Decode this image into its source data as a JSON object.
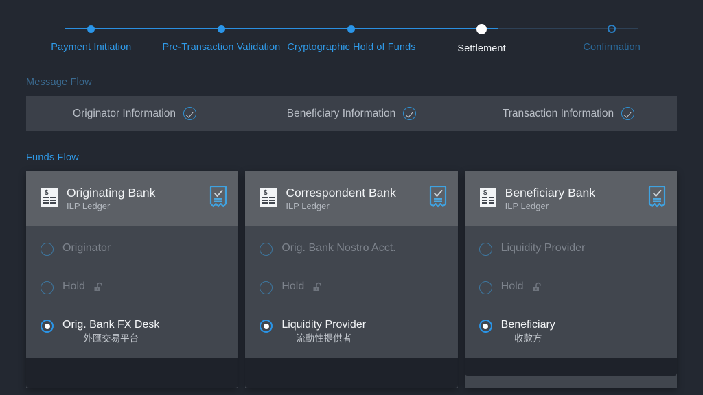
{
  "theme": {
    "background": "#232831",
    "accent_blue": "#2a95e8",
    "muted_blue": "#2a6a9b",
    "card_body": "#41464e",
    "card_header": "#5c6066",
    "bar": "#3b4049",
    "text_primary": "#f2f4f6",
    "text_muted": "#7d838c"
  },
  "stepper": {
    "steps": [
      {
        "label": "Payment Initiation",
        "state": "done"
      },
      {
        "label": "Pre-Transaction Validation",
        "state": "done"
      },
      {
        "label": "Cryptographic Hold of Funds",
        "state": "done"
      },
      {
        "label": "Settlement",
        "state": "current"
      },
      {
        "label": "Confirmation",
        "state": "future"
      }
    ]
  },
  "message_flow": {
    "label": "Message Flow",
    "items": [
      {
        "label": "Originator Information",
        "status_icon": "check-circle-icon",
        "checked": true
      },
      {
        "label": "Beneficiary Information",
        "status_icon": "check-circle-icon",
        "checked": true
      },
      {
        "label": "Transaction Information",
        "status_icon": "check-circle-icon",
        "checked": true
      }
    ]
  },
  "funds_flow": {
    "label": "Funds Flow",
    "cards": [
      {
        "title": "Originating Bank",
        "subtitle": "ILP Ledger",
        "header_icon": "receipt-icon",
        "badge_icon": "certificate-check-icon",
        "rows": [
          {
            "label": "Originator",
            "sub": "",
            "selected": false,
            "icon": ""
          },
          {
            "label": "Hold",
            "sub": "",
            "selected": false,
            "icon": "unlocked-padlock-icon"
          },
          {
            "label": "Orig. Bank FX Desk",
            "sub": "外匯交易平台",
            "selected": true,
            "icon": ""
          }
        ]
      },
      {
        "title": "Correspondent Bank",
        "subtitle": "ILP Ledger",
        "header_icon": "receipt-icon",
        "badge_icon": "certificate-check-icon",
        "rows": [
          {
            "label": "Orig. Bank Nostro Acct.",
            "sub": "",
            "selected": false,
            "icon": ""
          },
          {
            "label": "Hold",
            "sub": "",
            "selected": false,
            "icon": "unlocked-padlock-icon"
          },
          {
            "label": "Liquidity Provider",
            "sub": "流動性提供者",
            "selected": true,
            "icon": ""
          }
        ]
      },
      {
        "title": "Beneficiary Bank",
        "subtitle": "ILP Ledger",
        "header_icon": "receipt-icon",
        "badge_icon": "certificate-check-icon",
        "rows": [
          {
            "label": "Liquidity Provider",
            "sub": "",
            "selected": false,
            "icon": ""
          },
          {
            "label": "Hold",
            "sub": "",
            "selected": false,
            "icon": "unlocked-padlock-icon"
          },
          {
            "label": "Beneficiary",
            "sub": "收款方",
            "selected": true,
            "icon": ""
          }
        ]
      }
    ]
  }
}
